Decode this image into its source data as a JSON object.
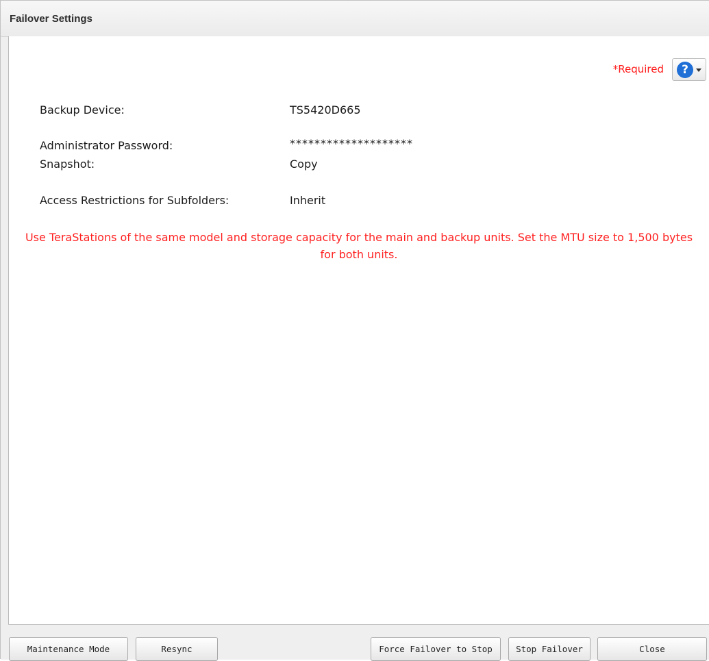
{
  "window": {
    "title": "Failover Settings"
  },
  "header": {
    "required_label": "*Required",
    "help_icon": "help-question-icon"
  },
  "fields": [
    {
      "label": "Backup Device:",
      "value": "TS5420D665"
    },
    {
      "label": "Administrator Password:",
      "value": "********************"
    },
    {
      "label": "Snapshot:",
      "value": "Copy"
    },
    {
      "label": "Access Restrictions for Subfolders:",
      "value": "Inherit"
    }
  ],
  "notice": "Use TeraStations of the same model and storage capacity for the main and backup units. Set the MTU size to 1,500 bytes for both units.",
  "buttons": {
    "maintenance_mode": "Maintenance Mode",
    "resync": "Resync",
    "force_failover_to_stop": "Force Failover to Stop",
    "stop_failover": "Stop Failover",
    "close": "Close"
  },
  "colors": {
    "required": "#ff1a1a",
    "notice": "#ff2020",
    "help_icon": "#1f6fd6"
  }
}
